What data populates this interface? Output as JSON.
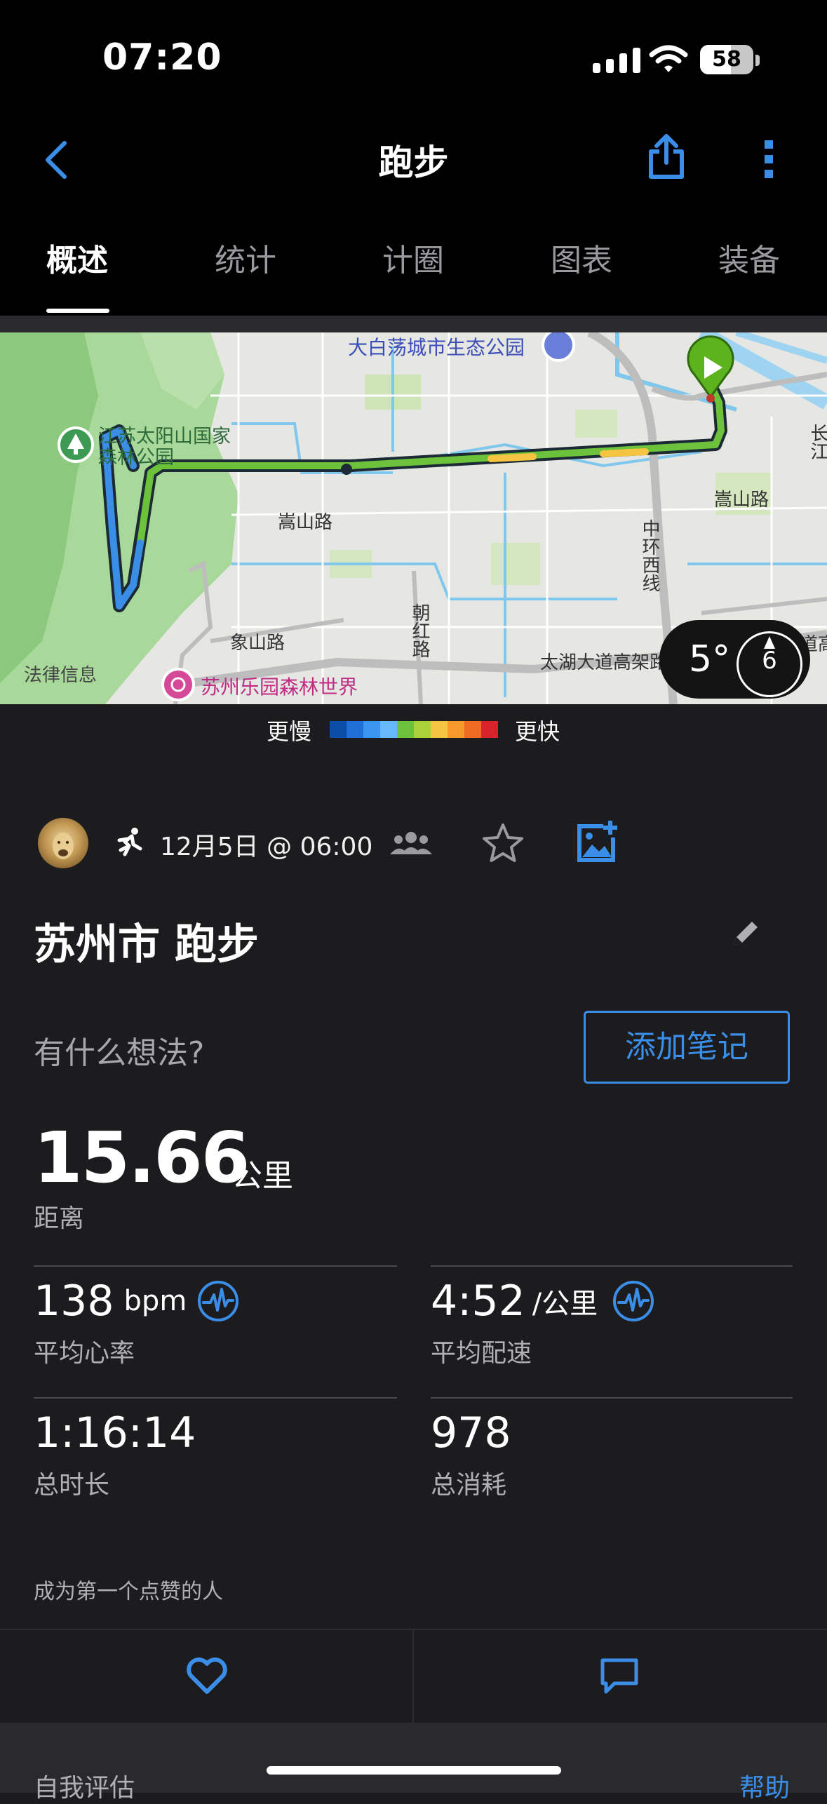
{
  "status": {
    "time": "07:20",
    "battery": "58",
    "battery_level": 0.58
  },
  "nav": {
    "title": "跑步"
  },
  "tabs": [
    {
      "label": "概述",
      "active": true
    },
    {
      "label": "统计",
      "active": false
    },
    {
      "label": "计圈",
      "active": false
    },
    {
      "label": "图表",
      "active": false
    },
    {
      "label": "装备",
      "active": false
    }
  ],
  "map": {
    "labels": {
      "park_north": "大白荡城市生态公园",
      "forest_park": "江苏太阳山国家森林公园",
      "road_songshan_w": "嵩山路",
      "road_songshan_e": "嵩山路",
      "road_zhonghuan": "中环西线",
      "road_chaohong": "朝红路",
      "road_xiangshan": "象山路",
      "road_taihu": "太湖大道高架路",
      "legal": "法律信息",
      "amusement": "苏州乐园森林世界",
      "edge_right": "长江",
      "edge_bottom_right": "道高"
    },
    "weather": {
      "temp": "5°",
      "wind": "6"
    }
  },
  "legend": {
    "slower": "更慢",
    "faster": "更快",
    "colors": [
      "#0a4ea8",
      "#1f6fd6",
      "#3a96ee",
      "#66b9ff",
      "#6cc23a",
      "#a8d13a",
      "#f5c542",
      "#f59a2a",
      "#ef6a22",
      "#d9232a"
    ]
  },
  "activity": {
    "date": "12月5日 @ 06:00",
    "title": "苏州市 跑步",
    "thoughts_placeholder": "有什么想法?",
    "add_note": "添加笔记",
    "distance": {
      "value": "15.66",
      "unit": "公里",
      "label": "距离"
    },
    "heart_rate": {
      "value": "138",
      "unit": "bpm",
      "label": "平均心率"
    },
    "pace": {
      "value": "4:52",
      "unit": "/公里",
      "label": "平均配速"
    },
    "duration": {
      "value": "1:16:14",
      "label": "总时长"
    },
    "calories": {
      "value": "978",
      "label": "总消耗"
    },
    "likes_text": "成为第一个点赞的人"
  },
  "footer": {
    "self_eval": "自我评估",
    "help": "帮助"
  },
  "colors": {
    "accent": "#3b8ee8",
    "background": "#1c1c1e",
    "route_green": "#6cc23a",
    "route_blue": "#3a8ee6"
  }
}
